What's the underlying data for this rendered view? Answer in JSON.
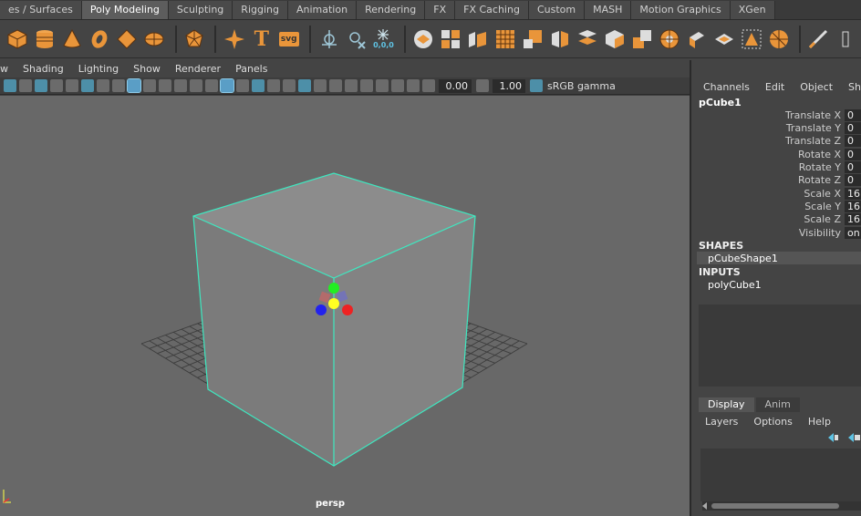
{
  "shelf_tabs": [
    "es / Surfaces",
    "Poly Modeling",
    "Sculpting",
    "Rigging",
    "Animation",
    "Rendering",
    "FX",
    "FX Caching",
    "Custom",
    "MASH",
    "Motion Graphics",
    "XGen"
  ],
  "shelf_active": "Poly Modeling",
  "shelf_icons": {
    "text_tool": "T",
    "svg_tool": "svg",
    "coords": "0,0,0"
  },
  "viewport": {
    "menu": [
      "w",
      "Shading",
      "Lighting",
      "Show",
      "Renderer",
      "Panels"
    ],
    "exposure": "0.00",
    "gamma": "1.00",
    "color_space": "sRGB gamma",
    "camera": "persp"
  },
  "channel_box": {
    "menu": [
      "Channels",
      "Edit",
      "Object",
      "Show"
    ],
    "object": "pCube1",
    "attributes": [
      {
        "label": "Translate X",
        "value": "0"
      },
      {
        "label": "Translate Y",
        "value": "0"
      },
      {
        "label": "Translate Z",
        "value": "0"
      },
      {
        "label": "Rotate X",
        "value": "0"
      },
      {
        "label": "Rotate Y",
        "value": "0"
      },
      {
        "label": "Rotate Z",
        "value": "0"
      },
      {
        "label": "Scale X",
        "value": "16"
      },
      {
        "label": "Scale Y",
        "value": "16"
      },
      {
        "label": "Scale Z",
        "value": "16"
      },
      {
        "label": "Visibility",
        "value": "on"
      }
    ],
    "shapes_label": "SHAPES",
    "shape": "pCubeShape1",
    "inputs_label": "INPUTS",
    "input": "polyCube1"
  },
  "layer_editor": {
    "tabs": [
      "Display",
      "Anim"
    ],
    "active_tab": "Display",
    "menu": [
      "Layers",
      "Options",
      "Help"
    ]
  },
  "colors": {
    "accent_orange": "#e9953a",
    "selection_cyan": "#3ee8c0",
    "viewport_bg": "#686868"
  }
}
